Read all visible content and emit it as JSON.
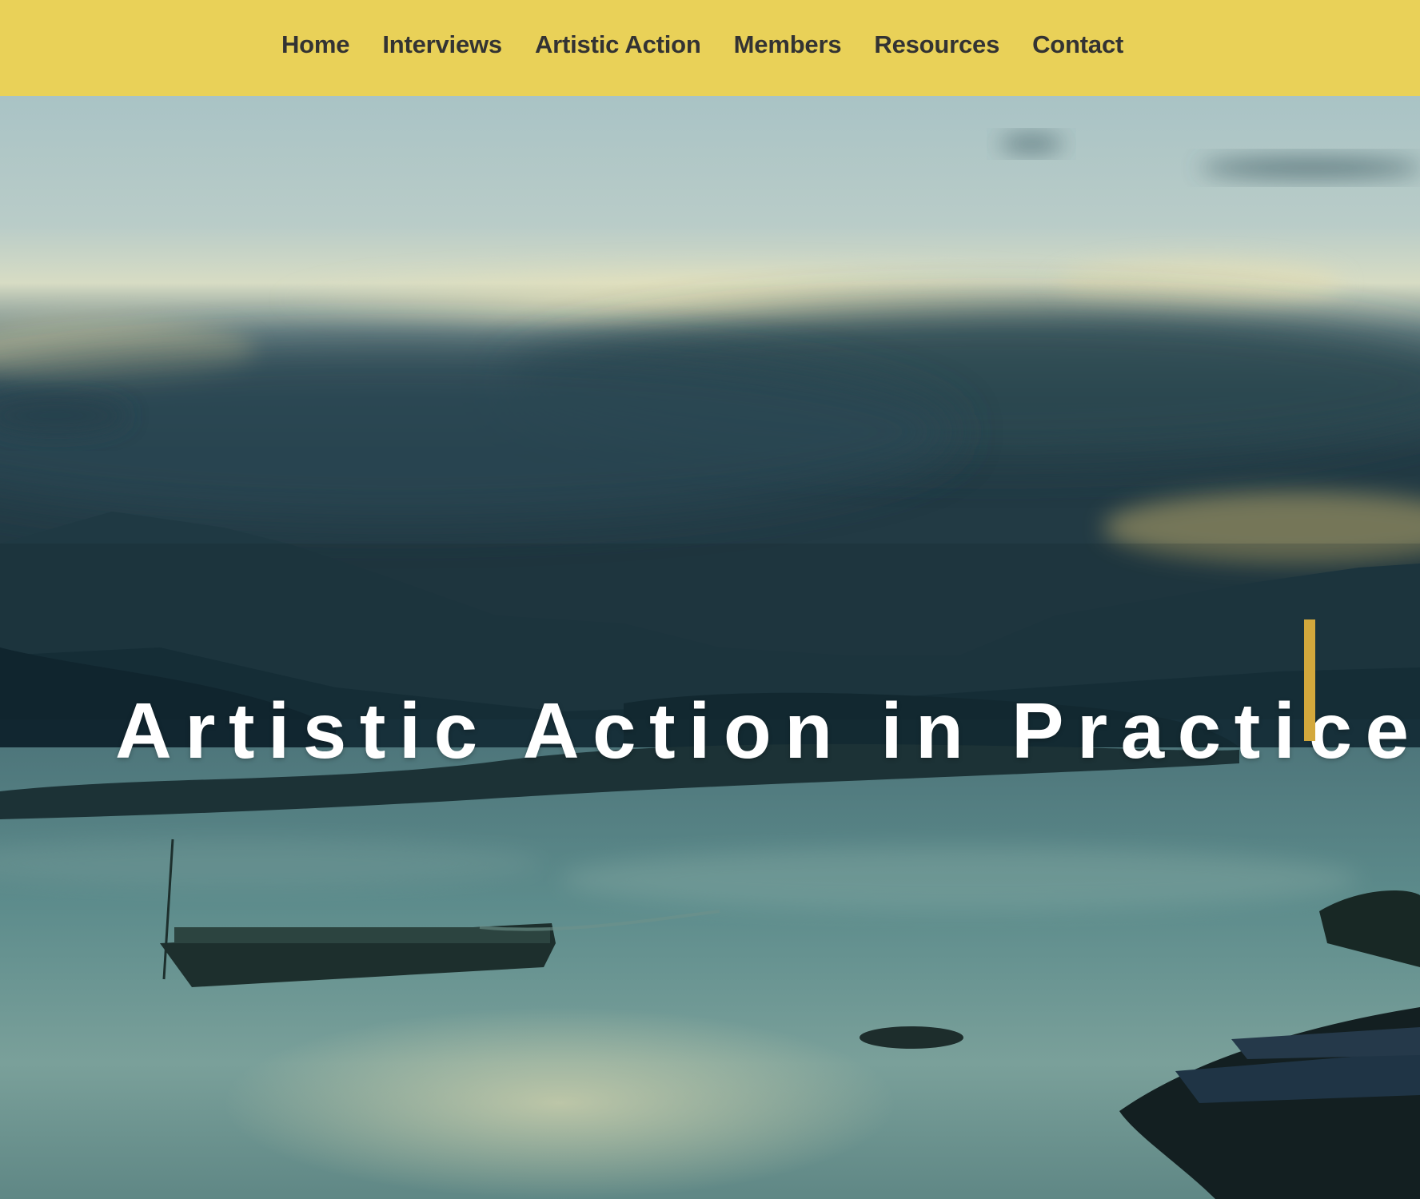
{
  "nav": {
    "items": [
      {
        "label": "Home"
      },
      {
        "label": "Interviews"
      },
      {
        "label": "Artistic Action"
      },
      {
        "label": "Members"
      },
      {
        "label": "Resources"
      },
      {
        "label": "Contact"
      }
    ]
  },
  "hero": {
    "title": "Artistic Action in Practice"
  },
  "colors": {
    "navbar_background": "#e9d158",
    "nav_text": "#333333",
    "hero_title": "#ffffff",
    "cursor_accent": "#d3a83c"
  }
}
